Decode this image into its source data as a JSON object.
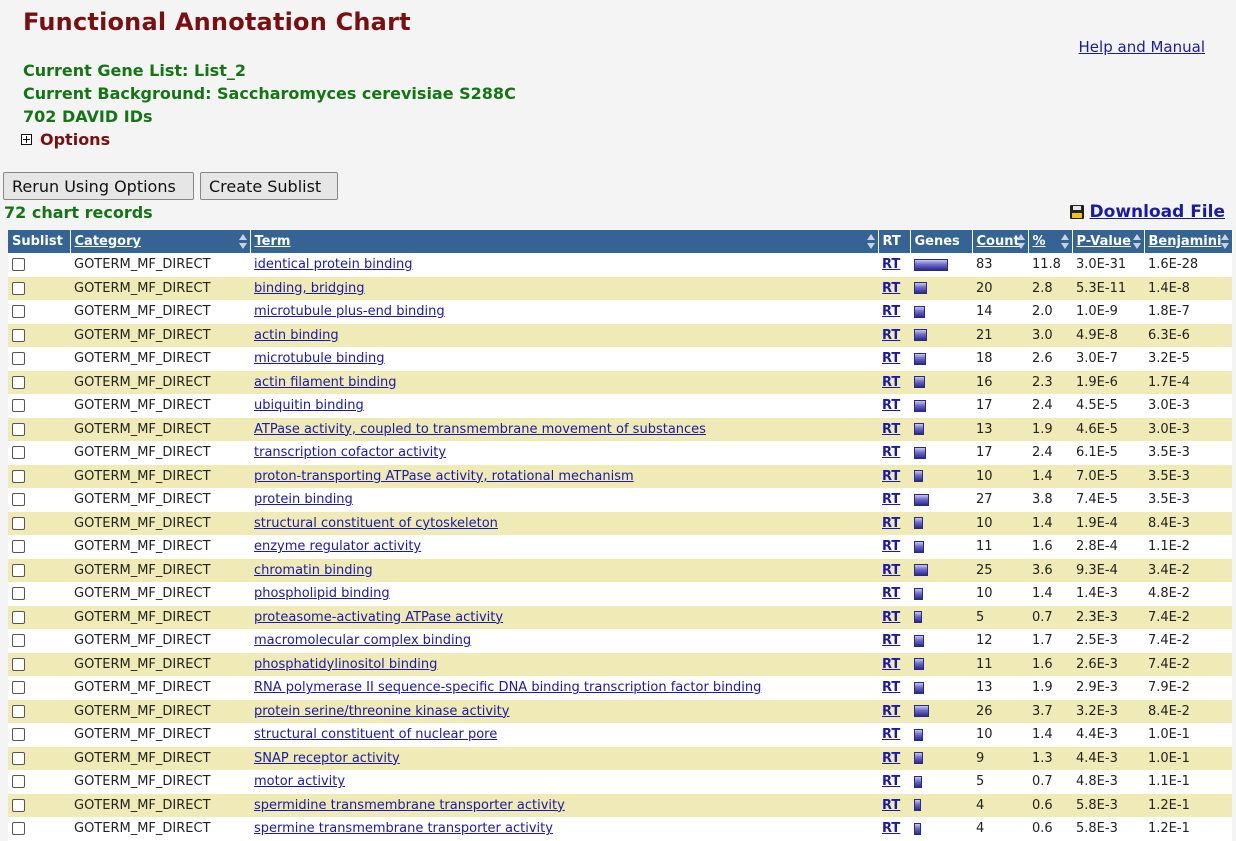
{
  "header": {
    "title": "Functional Annotation Chart",
    "help_link": "Help and Manual",
    "gene_list": "Current Gene List: List_2",
    "background": "Current Background: Saccharomyces cerevisiae S288C",
    "david_ids": "702 DAVID IDs",
    "options": "Options"
  },
  "toolbar": {
    "rerun_label": "Rerun Using Options",
    "create_sublist_label": "Create Sublist",
    "records_label": "72 chart records",
    "download_label": "Download File"
  },
  "table": {
    "columns": [
      "Sublist",
      "Category",
      "Term",
      "RT",
      "Genes",
      "Count",
      "%",
      "P-Value",
      "Benjamini"
    ],
    "rows": [
      {
        "category": "GOTERM_MF_DIRECT",
        "term": "identical protein binding",
        "rt": "RT",
        "count": "83",
        "percent": "11.8",
        "pvalue": "3.0E-31",
        "benjamini": "1.6E-28"
      },
      {
        "category": "GOTERM_MF_DIRECT",
        "term": "binding, bridging",
        "rt": "RT",
        "count": "20",
        "percent": "2.8",
        "pvalue": "5.3E-11",
        "benjamini": "1.4E-8"
      },
      {
        "category": "GOTERM_MF_DIRECT",
        "term": "microtubule plus-end binding",
        "rt": "RT",
        "count": "14",
        "percent": "2.0",
        "pvalue": "1.0E-9",
        "benjamini": "1.8E-7"
      },
      {
        "category": "GOTERM_MF_DIRECT",
        "term": "actin binding",
        "rt": "RT",
        "count": "21",
        "percent": "3.0",
        "pvalue": "4.9E-8",
        "benjamini": "6.3E-6"
      },
      {
        "category": "GOTERM_MF_DIRECT",
        "term": "microtubule binding",
        "rt": "RT",
        "count": "18",
        "percent": "2.6",
        "pvalue": "3.0E-7",
        "benjamini": "3.2E-5"
      },
      {
        "category": "GOTERM_MF_DIRECT",
        "term": "actin filament binding",
        "rt": "RT",
        "count": "16",
        "percent": "2.3",
        "pvalue": "1.9E-6",
        "benjamini": "1.7E-4"
      },
      {
        "category": "GOTERM_MF_DIRECT",
        "term": "ubiquitin binding",
        "rt": "RT",
        "count": "17",
        "percent": "2.4",
        "pvalue": "4.5E-5",
        "benjamini": "3.0E-3"
      },
      {
        "category": "GOTERM_MF_DIRECT",
        "term": "ATPase activity, coupled to transmembrane movement of substances",
        "rt": "RT",
        "count": "13",
        "percent": "1.9",
        "pvalue": "4.6E-5",
        "benjamini": "3.0E-3"
      },
      {
        "category": "GOTERM_MF_DIRECT",
        "term": "transcription cofactor activity",
        "rt": "RT",
        "count": "17",
        "percent": "2.4",
        "pvalue": "6.1E-5",
        "benjamini": "3.5E-3"
      },
      {
        "category": "GOTERM_MF_DIRECT",
        "term": "proton-transporting ATPase activity, rotational mechanism",
        "rt": "RT",
        "count": "10",
        "percent": "1.4",
        "pvalue": "7.0E-5",
        "benjamini": "3.5E-3"
      },
      {
        "category": "GOTERM_MF_DIRECT",
        "term": "protein binding",
        "rt": "RT",
        "count": "27",
        "percent": "3.8",
        "pvalue": "7.4E-5",
        "benjamini": "3.5E-3"
      },
      {
        "category": "GOTERM_MF_DIRECT",
        "term": "structural constituent of cytoskeleton",
        "rt": "RT",
        "count": "10",
        "percent": "1.4",
        "pvalue": "1.9E-4",
        "benjamini": "8.4E-3"
      },
      {
        "category": "GOTERM_MF_DIRECT",
        "term": "enzyme regulator activity",
        "rt": "RT",
        "count": "11",
        "percent": "1.6",
        "pvalue": "2.8E-4",
        "benjamini": "1.1E-2"
      },
      {
        "category": "GOTERM_MF_DIRECT",
        "term": "chromatin binding",
        "rt": "RT",
        "count": "25",
        "percent": "3.6",
        "pvalue": "9.3E-4",
        "benjamini": "3.4E-2"
      },
      {
        "category": "GOTERM_MF_DIRECT",
        "term": "phospholipid binding",
        "rt": "RT",
        "count": "10",
        "percent": "1.4",
        "pvalue": "1.4E-3",
        "benjamini": "4.8E-2"
      },
      {
        "category": "GOTERM_MF_DIRECT",
        "term": "proteasome-activating ATPase activity",
        "rt": "RT",
        "count": "5",
        "percent": "0.7",
        "pvalue": "2.3E-3",
        "benjamini": "7.4E-2"
      },
      {
        "category": "GOTERM_MF_DIRECT",
        "term": "macromolecular complex binding",
        "rt": "RT",
        "count": "12",
        "percent": "1.7",
        "pvalue": "2.5E-3",
        "benjamini": "7.4E-2"
      },
      {
        "category": "GOTERM_MF_DIRECT",
        "term": "phosphatidylinositol binding",
        "rt": "RT",
        "count": "11",
        "percent": "1.6",
        "pvalue": "2.6E-3",
        "benjamini": "7.4E-2"
      },
      {
        "category": "GOTERM_MF_DIRECT",
        "term": "RNA polymerase II sequence-specific DNA binding transcription factor binding",
        "rt": "RT",
        "count": "13",
        "percent": "1.9",
        "pvalue": "2.9E-3",
        "benjamini": "7.9E-2"
      },
      {
        "category": "GOTERM_MF_DIRECT",
        "term": "protein serine/threonine kinase activity",
        "rt": "RT",
        "count": "26",
        "percent": "3.7",
        "pvalue": "3.2E-3",
        "benjamini": "8.4E-2"
      },
      {
        "category": "GOTERM_MF_DIRECT",
        "term": "structural constituent of nuclear pore",
        "rt": "RT",
        "count": "10",
        "percent": "1.4",
        "pvalue": "4.4E-3",
        "benjamini": "1.0E-1"
      },
      {
        "category": "GOTERM_MF_DIRECT",
        "term": "SNAP receptor activity",
        "rt": "RT",
        "count": "9",
        "percent": "1.3",
        "pvalue": "4.4E-3",
        "benjamini": "1.0E-1"
      },
      {
        "category": "GOTERM_MF_DIRECT",
        "term": "motor activity",
        "rt": "RT",
        "count": "5",
        "percent": "0.7",
        "pvalue": "4.8E-3",
        "benjamini": "1.1E-1"
      },
      {
        "category": "GOTERM_MF_DIRECT",
        "term": "spermidine transmembrane transporter activity",
        "rt": "RT",
        "count": "4",
        "percent": "0.6",
        "pvalue": "5.8E-3",
        "benjamini": "1.2E-1"
      },
      {
        "category": "GOTERM_MF_DIRECT",
        "term": "spermine transmembrane transporter activity",
        "rt": "RT",
        "count": "4",
        "percent": "0.6",
        "pvalue": "5.8E-3",
        "benjamini": "1.2E-1"
      }
    ]
  }
}
